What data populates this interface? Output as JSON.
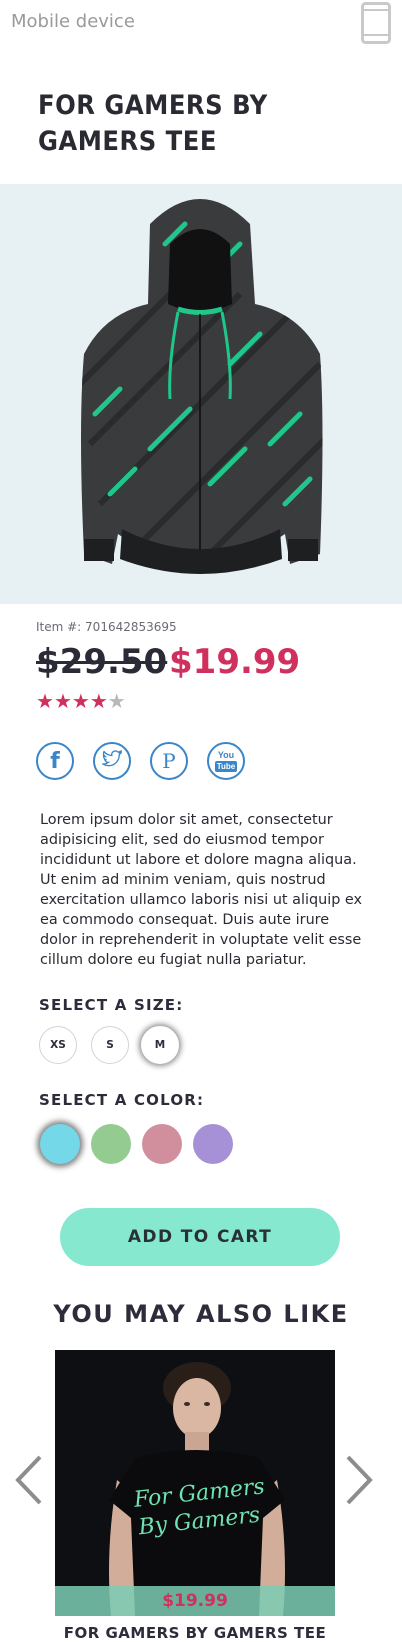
{
  "topbar": {
    "label": "Mobile device",
    "icon": "mobile-phone-icon"
  },
  "product": {
    "title": "FOR GAMERS BY GAMERS TEE",
    "image_icon": "hoodie-image",
    "item_number": "Item #: 701642853695",
    "old_price": "$29.50",
    "new_price": "$19.99",
    "rating": 4,
    "rating_max": 5,
    "description": "Lorem ipsum dolor sit amet, consectetur adipisicing elit, sed do eiusmod tempor incididunt ut labore et dolore magna aliqua. Ut enim ad minim veniam, quis nostrud exercitation ullamco laboris nisi ut aliquip ex ea commodo consequat. Duis aute irure dolor in reprehenderit in voluptate velit esse cillum dolore eu fugiat nulla pariatur."
  },
  "social": {
    "facebook": "f",
    "twitter_icon": "twitter-icon",
    "pinterest": "P",
    "youtube_top": "You",
    "youtube_bottom": "Tube"
  },
  "size": {
    "label": "SELECT A SIZE:",
    "options": [
      "XS",
      "S",
      "M"
    ],
    "selected": "M"
  },
  "color": {
    "label": "SELECT A COLOR:",
    "options": [
      "#74d8e8",
      "#93cb90",
      "#d18f9d",
      "#a791d6"
    ],
    "selected_index": 0
  },
  "cart": {
    "label": "ADD TO CART"
  },
  "recommendations": {
    "title": "YOU MAY ALSO LIKE",
    "items": [
      {
        "price": "$19.99",
        "name": "FOR GAMERS BY GAMERS TEE",
        "shirt_text_1": "For Gamers",
        "shirt_text_2": "By Gamers"
      }
    ]
  },
  "colors": {
    "accent": "#d0305e",
    "cta": "#86e8cf",
    "social": "#3a86c8"
  }
}
